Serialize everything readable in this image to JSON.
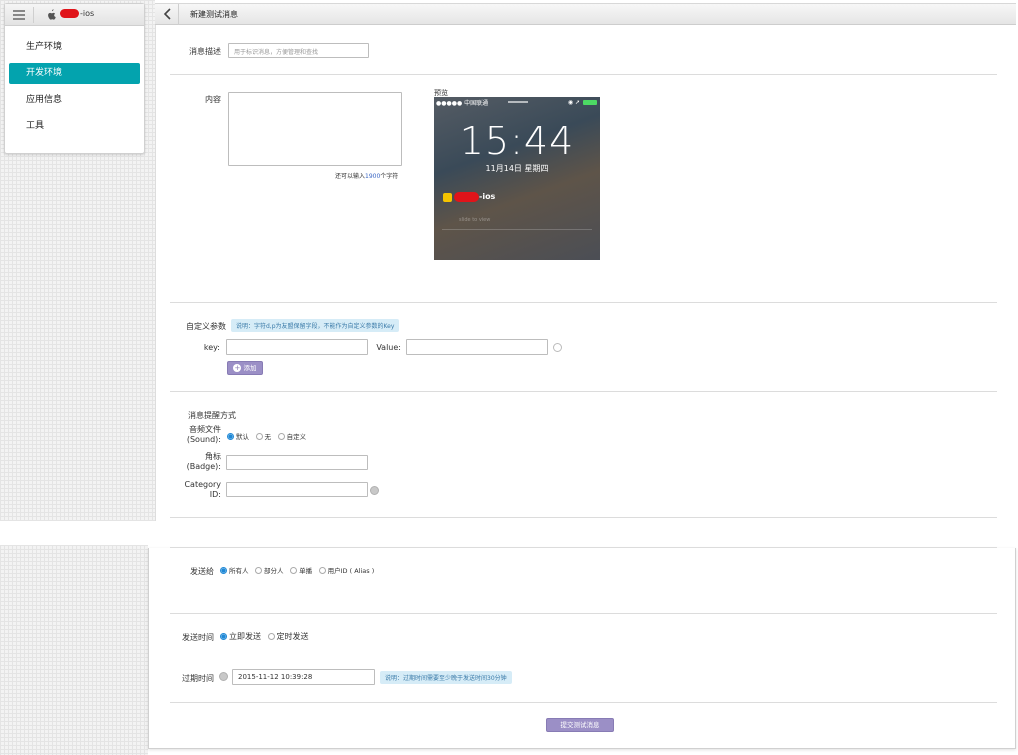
{
  "sidebar": {
    "app_suffix": "-ios",
    "items": [
      {
        "label": "生产环境"
      },
      {
        "label": "开发环境"
      },
      {
        "label": "应用信息"
      },
      {
        "label": "工具"
      }
    ]
  },
  "header": {
    "title": "新建测试消息"
  },
  "form": {
    "desc_label": "消息描述",
    "desc_placeholder": "用于标识消息，方便管理和查找",
    "content_label": "内容",
    "remaining_prefix": "还可以输入",
    "remaining_count": "1900",
    "remaining_suffix": "个字符",
    "preview_label": "预览",
    "custom_params_label": "自定义参数",
    "custom_params_note": "说明：字符d,p为友盟保留字段，不能作为自定义参数的Key",
    "key_label": "key:",
    "value_label": "Value:",
    "add_button": "添加",
    "reminder_title": "消息提醒方式",
    "sound_label_1": "音频文件",
    "sound_label_2": "(Sound):",
    "sound_options": [
      "默认",
      "无",
      "自定义"
    ],
    "badge_label_1": "角标",
    "badge_label_2": "(Badge):",
    "category_label_1": "Category",
    "category_label_2": "ID:",
    "send_to_label": "发送给",
    "send_to_options": [
      "所有人",
      "部分人",
      "单播",
      "用户ID ( Alias )"
    ],
    "send_time_label": "发送时间",
    "send_time_options": [
      "立即发送",
      "定时发送"
    ],
    "expire_label": "过期时间",
    "expire_value": "2015-11-12 10:39:28",
    "expire_note": "说明：过期时间需要至少晚于发送时间30分钟",
    "submit_button": "提交测试消息"
  },
  "preview": {
    "carrier": "●●●●● 中国联通",
    "time": "15:44",
    "date": "11月14日 星期四",
    "app_name": "-ios",
    "slide_text": "slide to view"
  },
  "colors": {
    "accent": "#03a3ae",
    "button": "#9b8fc6",
    "note_bg": "#d6ecf7"
  }
}
